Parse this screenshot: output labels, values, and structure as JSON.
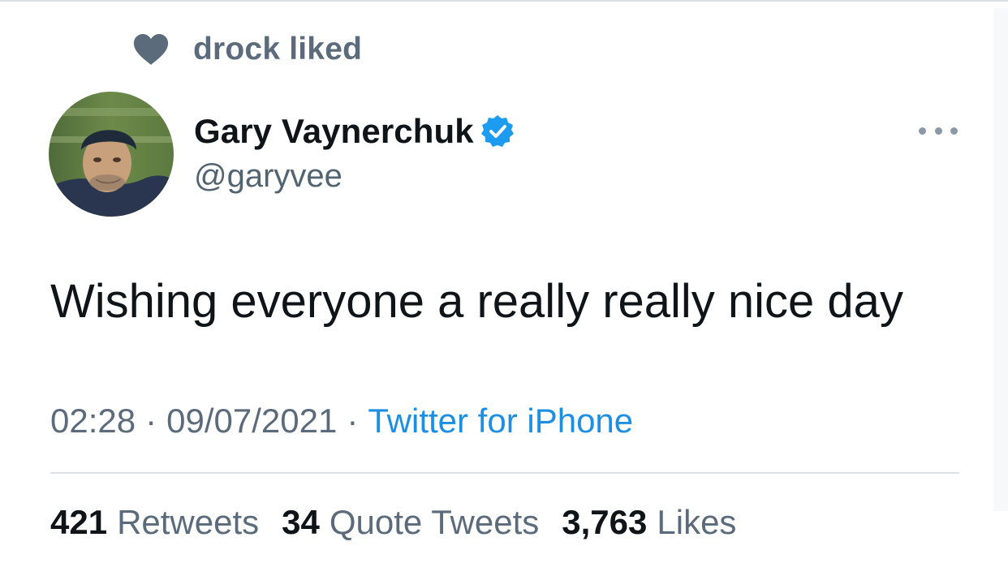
{
  "social_context": {
    "icon": "heart-icon",
    "text": "drock liked"
  },
  "author": {
    "name": "Gary Vaynerchuk",
    "handle": "@garyvee",
    "verified": true,
    "badge_icon": "verified-badge-icon",
    "avatar": "avatar-photo"
  },
  "more_menu": {
    "icon": "more-options-icon"
  },
  "tweet": {
    "text": "Wishing everyone a really really nice day"
  },
  "meta": {
    "time": "02:28",
    "separator": "·",
    "date": "09/07/2021",
    "source": "Twitter for iPhone"
  },
  "stats": {
    "retweets": {
      "count": "421",
      "label": "Retweets"
    },
    "quote_tweets": {
      "count": "34",
      "label": "Quote Tweets"
    },
    "likes": {
      "count": "3,763",
      "label": "Likes"
    }
  },
  "colors": {
    "primary_text": "#0f1419",
    "secondary_text": "#5b6b7b",
    "link": "#1d8fe2",
    "verified": "#1d9bf0"
  }
}
